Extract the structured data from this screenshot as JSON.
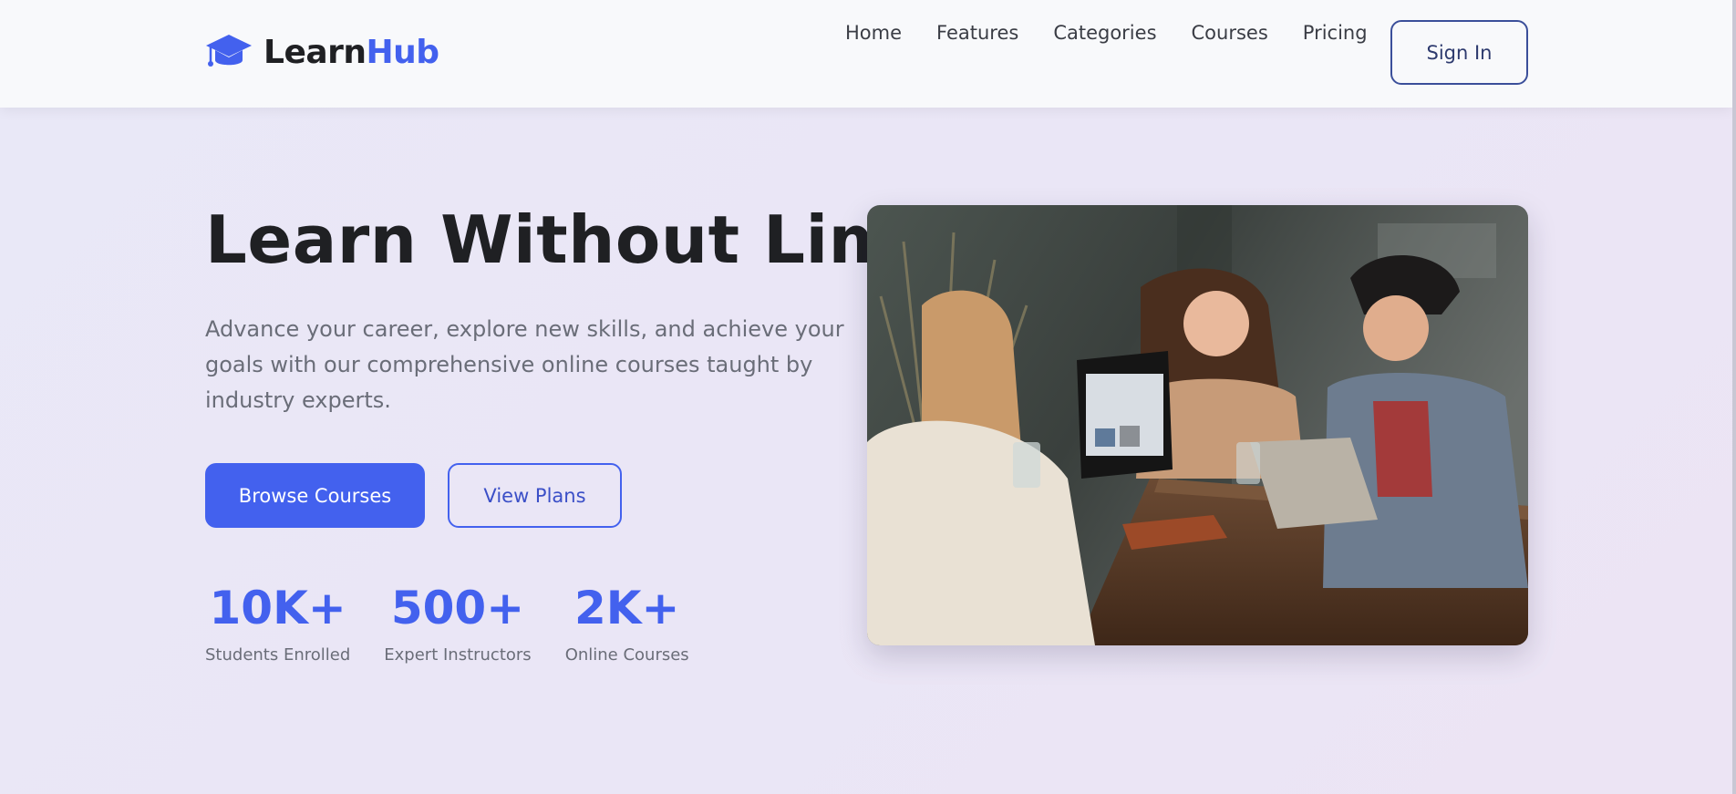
{
  "brand": {
    "name_part1": "Learn",
    "name_part2": "Hub",
    "icon": "graduation-cap-icon",
    "accent_color": "#4361ee"
  },
  "nav": {
    "links": [
      {
        "label": "Home"
      },
      {
        "label": "Features"
      },
      {
        "label": "Categories"
      },
      {
        "label": "Courses"
      },
      {
        "label": "Pricing"
      }
    ],
    "signin_label": "Sign In"
  },
  "hero": {
    "title": "Learn Without Limits",
    "subtitle": "Advance your career, explore new skills, and achieve your goals with our comprehensive online courses taught by industry experts.",
    "primary_button": "Browse Courses",
    "secondary_button": "View Plans",
    "image": "photo of three people laughing around a table with laptops"
  },
  "stats": [
    {
      "value": "10K+",
      "label": "Students Enrolled"
    },
    {
      "value": "500+",
      "label": "Expert Instructors"
    },
    {
      "value": "2K+",
      "label": "Online Courses"
    }
  ]
}
